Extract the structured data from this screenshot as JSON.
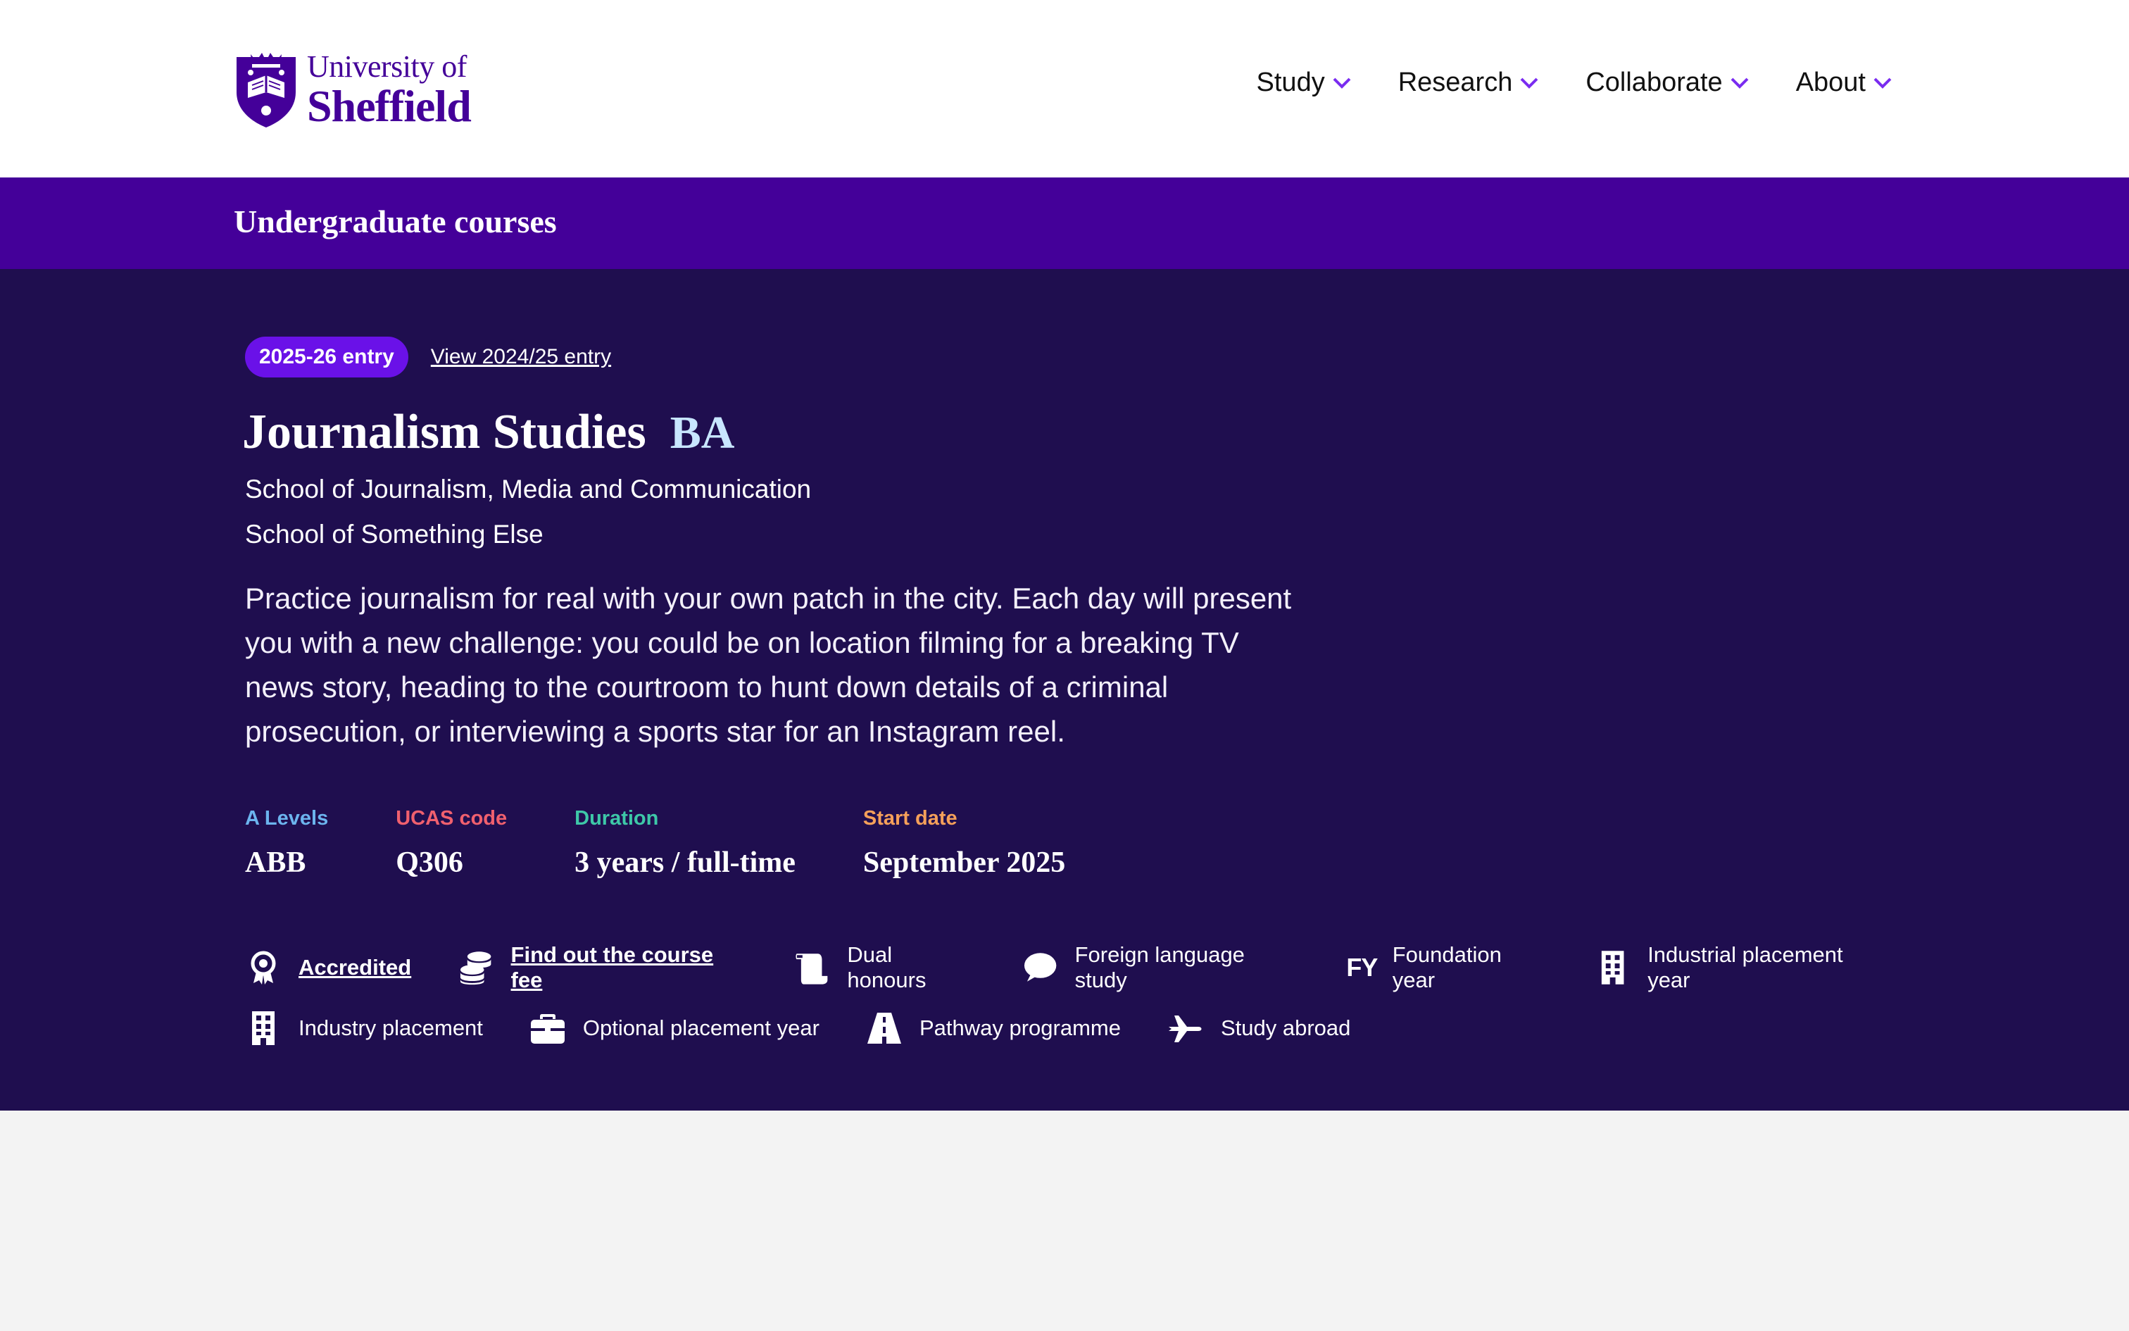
{
  "header": {
    "logo": {
      "line1": "University of",
      "line2": "Sheffield",
      "icon": "university-crest-icon"
    },
    "nav": [
      {
        "label": "Study",
        "icon": "chevron-down-icon"
      },
      {
        "label": "Research",
        "icon": "chevron-down-icon"
      },
      {
        "label": "Collaborate",
        "icon": "chevron-down-icon"
      },
      {
        "label": "About",
        "icon": "chevron-down-icon"
      }
    ]
  },
  "banner": {
    "title": "Undergraduate courses"
  },
  "course": {
    "entry_badge": "2025-26 entry",
    "entry_link": "View 2024/25 entry",
    "title": "Journalism Studies",
    "award": "BA",
    "schools": [
      "School of Journalism, Media and Communication",
      "School of Something Else"
    ],
    "summary": "Practice journalism for real with your own patch in the city. Each day will present you with a new challenge: you could be on location filming for a breaking TV news story, heading to the courtroom to hunt down details of a criminal prosecution, or interviewing a sports star for an Instagram reel.",
    "facts": [
      {
        "label": "A Levels",
        "value": "ABB",
        "color": "#6cb4ee"
      },
      {
        "label": "UCAS code",
        "value": "Q306",
        "color": "#f0606e"
      },
      {
        "label": "Duration",
        "value": "3 years / full-time",
        "color": "#3ec8a8"
      },
      {
        "label": "Start date",
        "value": "September 2025",
        "color": "#f5a05a"
      }
    ],
    "features": [
      {
        "label": "Accredited",
        "icon": "award-rosette-icon",
        "link": true
      },
      {
        "label": "Find out the course fee",
        "icon": "coins-icon",
        "link": true
      },
      {
        "label": "Dual honours",
        "icon": "scroll-icon",
        "link": false
      },
      {
        "label": "Foreign language study",
        "icon": "speech-bubble-icon",
        "link": false
      },
      {
        "label": "Foundation year",
        "icon": "fy-icon",
        "glyph": "FY",
        "link": false
      },
      {
        "label": "Industrial placement year",
        "icon": "building-icon",
        "link": false
      },
      {
        "label": "Industry placement",
        "icon": "building-icon",
        "link": false
      },
      {
        "label": "Optional placement year",
        "icon": "briefcase-icon",
        "link": false
      },
      {
        "label": "Pathway programme",
        "icon": "road-icon",
        "link": false
      },
      {
        "label": "Study abroad",
        "icon": "plane-icon",
        "link": false
      }
    ]
  },
  "colors": {
    "brand_purple": "#440099",
    "hero_bg": "#1f0e4f",
    "badge": "#6a11e8",
    "page_bg": "#f3f3f3"
  }
}
